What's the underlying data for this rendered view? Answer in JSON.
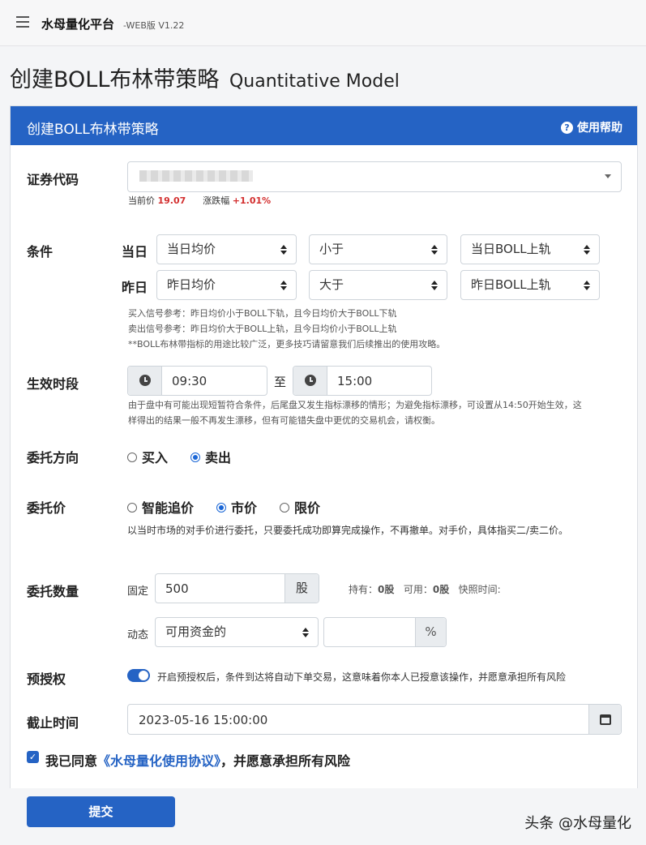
{
  "header": {
    "app_name": "水母量化平台",
    "version": "-WEB版 V1.22"
  },
  "page": {
    "title": "创建BOLL布林带策略",
    "title_sub": "Quantitative Model"
  },
  "card": {
    "title": "创建BOLL布林带策略",
    "help_label": "使用帮助"
  },
  "security": {
    "label": "证券代码",
    "current_price_label": "当前价",
    "current_price": "19.07",
    "change_label": "涨跌幅",
    "change": "+1.01%"
  },
  "conditions": {
    "label": "条件",
    "today": {
      "label": "当日",
      "left": "当日均价",
      "op": "小于",
      "right": "当日BOLL上轨"
    },
    "yesterday": {
      "label": "昨日",
      "left": "昨日均价",
      "op": "大于",
      "right": "昨日BOLL上轨"
    },
    "hints": [
      "买入信号参考：昨日均价小于BOLL下轨，且今日均价大于BOLL下轨",
      "卖出信号参考：昨日均价大于BOLL上轨，且今日均价小于BOLL上轨",
      "**BOLL布林带指标的用途比较广泛，更多技巧请留意我们后续推出的使用攻略。"
    ]
  },
  "period": {
    "label": "生效时段",
    "start": "09:30",
    "sep": "至",
    "end": "15:00",
    "note_1": "由于盘中有可能出现短暂符合条件，后尾盘又发生指标漂移的情形；为避免指标漂移，可设置从14:50开始生效，这",
    "note_2": "样得出的结果一般不再发生漂移，但有可能错失盘中更优的交易机会，请权衡。"
  },
  "direction": {
    "label": "委托方向",
    "buy": "买入",
    "sell": "卖出",
    "selected": "卖出"
  },
  "price": {
    "label": "委托价",
    "smart": "智能追价",
    "market": "市价",
    "limit": "限价",
    "selected": "市价",
    "note": "以当时市场的对手价进行委托，只要委托成功即算完成操作，不再撤单。对手价，具体指买二/卖二价。"
  },
  "quantity": {
    "label": "委托数量",
    "fixed_label": "固定",
    "fixed_value": "500",
    "unit": "股",
    "hold_label": "持有：",
    "hold_value": "0股",
    "avail_label": "可用：",
    "avail_value": "0股",
    "snapshot_label": "快照时间:",
    "dynamic_label": "动态",
    "dynamic_select": "可用资金的",
    "pct_value": "",
    "pct_unit": "%"
  },
  "preauth": {
    "label": "预授权",
    "enabled": true,
    "text": "开启预授权后，条件到达将自动下单交易，这意味着你本人已授意该操作，并愿意承担所有风险"
  },
  "deadline": {
    "label": "截止时间",
    "value": "2023-05-16 15:00:00"
  },
  "agreement": {
    "prefix": "我已同意",
    "link": "《水母量化使用协议》",
    "suffix": "，并愿意承担所有风险",
    "checked": true
  },
  "submit_label": "提交",
  "watermark": "头条 @水母量化",
  "colors": {
    "primary": "#2563c4",
    "up": "#d32f2f"
  }
}
